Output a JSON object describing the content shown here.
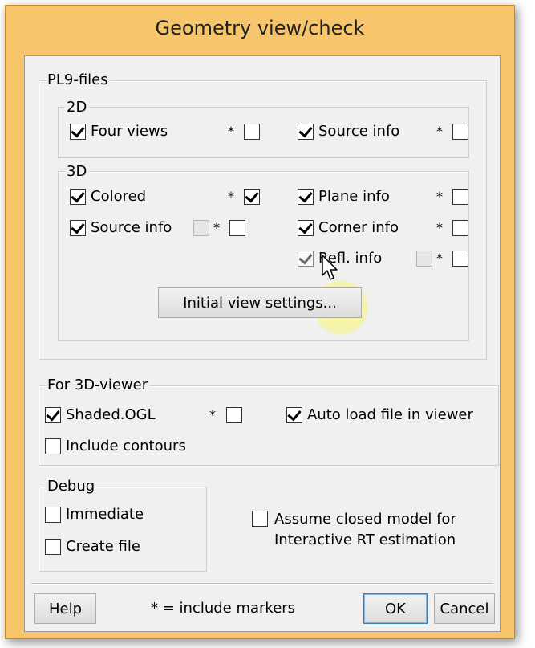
{
  "dialog": {
    "title": "Geometry view/check"
  },
  "pl9": {
    "legend": "PL9-files",
    "group2d": {
      "legend": "2D",
      "four_views": {
        "label": "Four views",
        "checked": true,
        "markers": false
      },
      "source_info": {
        "label": "Source info",
        "checked": true,
        "markers": false
      }
    },
    "group3d": {
      "legend": "3D",
      "colored": {
        "label": "Colored",
        "checked": true,
        "markers": true
      },
      "source_info": {
        "label": "Source info",
        "checked": true,
        "extra_disabled": true,
        "markers": false
      },
      "plane_info": {
        "label": "Plane info",
        "checked": true,
        "markers": false
      },
      "corner_info": {
        "label": "Corner info",
        "checked": true,
        "markers": false
      },
      "refl_info": {
        "label": "Refl. info",
        "checked": true,
        "extra_disabled": true,
        "markers": false
      },
      "initial_view_button": "Initial view settings..."
    }
  },
  "viewer3d": {
    "legend": "For 3D-viewer",
    "shaded_ogl": {
      "label": "Shaded.OGL",
      "checked": true,
      "markers": false
    },
    "auto_load": {
      "label": "Auto load file in viewer",
      "checked": true
    },
    "include_contours": {
      "label": "Include contours",
      "checked": false
    }
  },
  "debug": {
    "legend": "Debug",
    "immediate": {
      "label": "Immediate",
      "checked": false
    },
    "create_file": {
      "label": "Create file",
      "checked": false
    }
  },
  "assume_closed": {
    "line1": "Assume closed model for",
    "line2": "Interactive RT estimation",
    "checked": false
  },
  "star_marker": "*",
  "footer": {
    "help": "Help",
    "note": "* = include markers",
    "ok": "OK",
    "cancel": "Cancel"
  },
  "colors": {
    "frame": "#f6c56c",
    "client": "#f0f0f0",
    "cursor_highlight": "#faf578"
  },
  "cursor": {
    "icon": "arrow-pointer-icon"
  }
}
